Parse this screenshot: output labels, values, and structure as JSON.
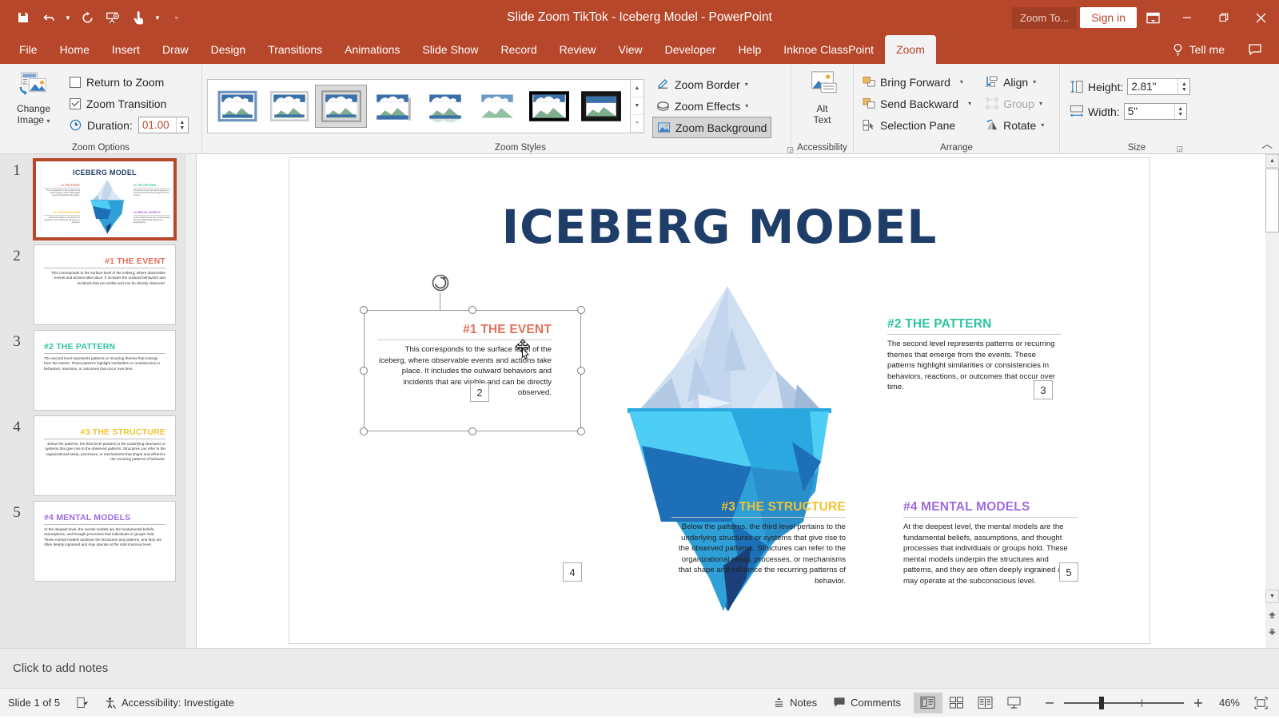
{
  "titlebar": {
    "document_title": "Slide Zoom TikTok - Iceberg Model  -  PowerPoint",
    "zoom_contextual_label": "Zoom To...",
    "signin_label": "Sign in",
    "qat": [
      {
        "name": "save",
        "icon": "save-icon"
      },
      {
        "name": "undo",
        "icon": "undo-icon"
      },
      {
        "name": "redo",
        "icon": "redo-icon"
      },
      {
        "name": "start-from-beginning",
        "icon": "presentation-icon"
      },
      {
        "name": "touch-mouse-mode",
        "icon": "touch-mode-icon"
      },
      {
        "name": "customize-qat",
        "icon": "chevron-down-icon"
      }
    ],
    "window_buttons": [
      "ribbon-display-options",
      "minimize",
      "restore",
      "close"
    ]
  },
  "tabs": [
    {
      "label": "File",
      "active": false
    },
    {
      "label": "Home",
      "active": false
    },
    {
      "label": "Insert",
      "active": false
    },
    {
      "label": "Draw",
      "active": false
    },
    {
      "label": "Design",
      "active": false
    },
    {
      "label": "Transitions",
      "active": false
    },
    {
      "label": "Animations",
      "active": false
    },
    {
      "label": "Slide Show",
      "active": false
    },
    {
      "label": "Record",
      "active": false
    },
    {
      "label": "Review",
      "active": false
    },
    {
      "label": "View",
      "active": false
    },
    {
      "label": "Developer",
      "active": false
    },
    {
      "label": "Help",
      "active": false
    },
    {
      "label": "Inknoe ClassPoint",
      "active": false
    },
    {
      "label": "Zoom",
      "active": true
    }
  ],
  "tellme_label": "Tell me",
  "ribbon": {
    "zoom_options": {
      "group_label": "Zoom Options",
      "change_image_label_1": "Change",
      "change_image_label_2": "Image",
      "return_to_zoom_label": "Return to Zoom",
      "return_to_zoom_checked": false,
      "zoom_transition_label": "Zoom Transition",
      "zoom_transition_checked": true,
      "duration_label": "Duration:",
      "duration_value": "01.00"
    },
    "zoom_styles": {
      "group_label": "Zoom Styles",
      "selected_index": 2,
      "thumb_count": 8
    },
    "zoom_tools": {
      "zoom_border_label": "Zoom Border",
      "zoom_effects_label": "Zoom Effects",
      "zoom_background_label": "Zoom Background",
      "zoom_background_pressed": true
    },
    "accessibility": {
      "group_label": "Accessibility",
      "alt_text_label_1": "Alt",
      "alt_text_label_2": "Text"
    },
    "arrange": {
      "group_label": "Arrange",
      "bring_forward_label": "Bring Forward",
      "send_backward_label": "Send Backward",
      "selection_pane_label": "Selection Pane",
      "align_label": "Align",
      "group_button_label": "Group",
      "group_button_disabled": true,
      "rotate_label": "Rotate"
    },
    "size": {
      "group_label": "Size",
      "height_label": "Height:",
      "height_value": "2.81\"",
      "width_label": "Width:",
      "width_value": "5\""
    }
  },
  "thumbnails": [
    {
      "number": "1",
      "title": "ICEBERG MODEL",
      "selected": true,
      "kind": "overview"
    },
    {
      "number": "2",
      "title": "#1 THE EVENT",
      "color": "#e2705c",
      "align": "right",
      "body": "This corresponds to the surface level of the iceberg, where observable events and actions take place. It includes the outward behaviors and incidents that are visible and can be directly observed.",
      "selected": false,
      "kind": "text"
    },
    {
      "number": "3",
      "title": "#2 THE PATTERN",
      "color": "#2fc4a0",
      "align": "left",
      "body": "The second level represents patterns or recurring themes that emerge from the events. These patterns highlight similarities or consistencies in behaviors, reactions, or outcomes that occur over time.",
      "selected": false,
      "kind": "text"
    },
    {
      "number": "4",
      "title": "#3 THE STRUCTURE",
      "color": "#f2c230",
      "align": "right",
      "body": "Below the patterns, the third level pertains to the underlying structures or systems that give rise to the observed patterns. Structures can refer to the organizational setup, processes, or mechanisms that shape and influence the recurring patterns of behavior.",
      "selected": false,
      "kind": "text"
    },
    {
      "number": "5",
      "title": "#4 MENTAL MODELS",
      "color": "#a06be0",
      "align": "left",
      "body": "At the deepest level, the mental models are the fundamental beliefs, assumptions, and thought processes that individuals or groups hold. These mental models underpin the structures and patterns, and they are often deeply ingrained and may operate at the subconscious level.",
      "selected": false,
      "kind": "text"
    }
  ],
  "slide": {
    "title": "ICEBERG MODEL",
    "title_color": "#1f3d69",
    "blocks": [
      {
        "heading": "#1 THE EVENT",
        "color": "#e2705c",
        "align": "right",
        "body": "This corresponds to the surface level of the iceberg, where observable events and actions take place. It includes the outward behaviors and incidents that are visible and can be directly observed.",
        "badge": "2",
        "selected": true
      },
      {
        "heading": "#2 THE PATTERN",
        "color": "#2fc4a0",
        "align": "left",
        "body": "The second level represents patterns or recurring themes that emerge from the events. These patterns highlight similarities or consistencies in behaviors, reactions, or outcomes that occur over time.",
        "badge": "3",
        "selected": false
      },
      {
        "heading": "#3 THE STRUCTURE",
        "color": "#f2c230",
        "align": "right",
        "body": "Below the patterns, the third level pertains to the underlying structures or systems that give rise to the observed patterns. Structures can refer to the organizational setup, processes, or mechanisms that shape and influence the recurring patterns of behavior.",
        "badge": "4",
        "selected": false
      },
      {
        "heading": "#4 MENTAL MODELS",
        "color": "#a06be0",
        "align": "left",
        "body": "At the deepest level, the mental models are the fundamental beliefs, assumptions, and thought processes that individuals or groups hold. These mental models underpin the structures and patterns, and they are often deeply ingrained and may operate at the subconscious level.",
        "badge": "5",
        "selected": false
      }
    ],
    "iceberg_colors": {
      "above_light": "#dbe7f5",
      "above_mid": "#c3d6ee",
      "above_shadow": "#9fb9d8",
      "water_line": "#2aa9e0",
      "below_cyan": "#4ecdf5",
      "below_mid": "#2f9fd8",
      "below_deep": "#1d6fb8",
      "below_darkest": "#1b3f78"
    }
  },
  "notes_placeholder": "Click to add notes",
  "statusbar": {
    "slide_indicator": "Slide 1 of 5",
    "accessibility_label": "Accessibility: Investigate",
    "notes_label": "Notes",
    "comments_label": "Comments",
    "zoom_percent": "46%",
    "views": [
      {
        "name": "normal-view",
        "active": true
      },
      {
        "name": "slide-sorter-view",
        "active": false
      },
      {
        "name": "reading-view",
        "active": false
      },
      {
        "name": "slide-show-view",
        "active": false
      }
    ]
  }
}
